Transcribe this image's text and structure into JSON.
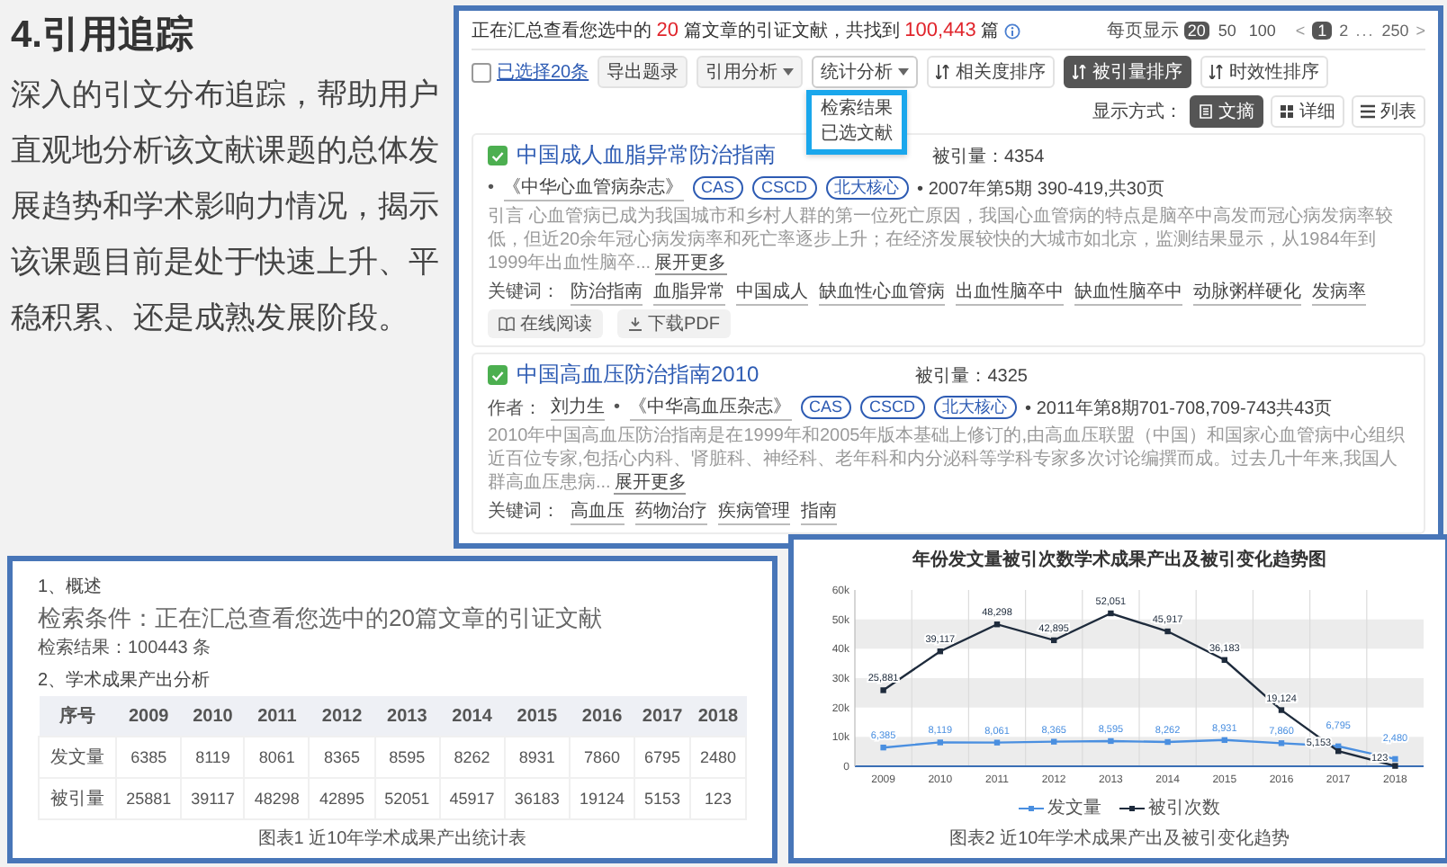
{
  "intro": {
    "heading": "4.引用追踪",
    "body": "深入的引文分布追踪，帮助用户直观地分析该文献课题的总体发展趋势和学术影响力情况，揭示该课题目前是处于快速上升、平稳积累、还是成熟发展阶段。"
  },
  "citation_panel": {
    "summary": [
      {
        "text": "正在汇总查看您选中的 ",
        "emphasis": false
      },
      {
        "text": "20",
        "emphasis": true
      },
      {
        "text": " 篇文章的引证文献，共找到 ",
        "emphasis": false
      },
      {
        "text": "100,443",
        "emphasis": true
      },
      {
        "text": " 篇",
        "emphasis": false
      }
    ],
    "per_page": {
      "label": "每页显示",
      "options": [
        {
          "label": "20",
          "selected": true
        },
        {
          "label": "50",
          "selected": false
        },
        {
          "label": "100",
          "selected": false
        }
      ]
    },
    "pagination": [
      {
        "label": "<",
        "kind": "arrow",
        "selected": false
      },
      {
        "label": "1",
        "kind": "page",
        "selected": true
      },
      {
        "label": "2",
        "kind": "page",
        "selected": false
      },
      {
        "label": "...",
        "kind": "gap",
        "selected": false
      },
      {
        "label": "250",
        "kind": "page",
        "selected": false
      },
      {
        "label": ">",
        "kind": "arrow",
        "selected": false
      }
    ],
    "toolbar": {
      "select_all": {
        "label": "已选择20条",
        "checked": false
      },
      "buttons": [
        {
          "label": "导出题录",
          "kind": "plain",
          "expanded": false
        },
        {
          "label": "引用分析",
          "kind": "dropdown",
          "expanded": false
        },
        {
          "label": "统计分析",
          "kind": "dropdown",
          "expanded": true,
          "menu": [
            "检索结果",
            "已选文献"
          ]
        }
      ],
      "sorts": [
        {
          "label": "相关度排序",
          "selected": false
        },
        {
          "label": "被引量排序",
          "selected": true
        },
        {
          "label": "时效性排序",
          "selected": false
        }
      ],
      "display_label": "显示方式：",
      "display_modes": [
        {
          "label": "文摘",
          "kind": "abstract",
          "selected": true
        },
        {
          "label": "详细",
          "kind": "detail",
          "selected": false
        },
        {
          "label": "列表",
          "kind": "list",
          "selected": false
        }
      ]
    },
    "results": [
      {
        "checked": true,
        "title": "中国成人血脂异常防治指南",
        "cited": "被引量：4354",
        "journal_bullet": "•",
        "journal": "《中华心血管病杂志》",
        "badges": [
          "CAS",
          "CSCD",
          "北大核心"
        ],
        "issue": "• 2007年第5期 390-419,共30页",
        "abstract": "引言 心血管病已成为我国城市和乡村人群的第一位死亡原因，我国心血管病的特点是脑卒中高发而冠心病发病率较低，但近20余年冠心病发病率和死亡率逐步上升；在经济发展较快的大城市如北京，监测结果显示，从1984年到1999年出血性脑卒...",
        "more": "展开更多",
        "keywords_label": "关键词：",
        "keywords": [
          "防治指南",
          "血脂异常",
          "中国成人",
          "缺血性心血管病",
          "出血性脑卒中",
          "缺血性脑卒中",
          "动脉粥样硬化",
          "发病率"
        ],
        "actions": [
          {
            "label": "在线阅读",
            "kind": "read"
          },
          {
            "label": "下载PDF",
            "kind": "download"
          }
        ]
      },
      {
        "checked": true,
        "title": "中国高血压防治指南2010",
        "cited": "被引量：4325",
        "author_label": "作者：",
        "author": "刘力生",
        "journal_bullet": "•",
        "journal": "《中华高血压杂志》",
        "badges": [
          "CAS",
          "CSCD",
          "北大核心"
        ],
        "issue": "• 2011年第8期701-708,709-743共43页",
        "abstract": "2010年中国高血压防治指南是在1999年和2005年版本基础上修订的,由高血压联盟（中国）和国家心血管病中心组织近百位专家,包括心内科、肾脏科、神经科、老年科和内分泌科等学科专家多次讨论编撰而成。过去几十年来,我国人群高血压患病...",
        "more": "展开更多",
        "keywords_label": "关键词：",
        "keywords": [
          "高血压",
          "药物治疗",
          "疾病管理",
          "指南"
        ]
      }
    ]
  },
  "report": {
    "section1": "1、概述",
    "condition": "检索条件：正在汇总查看您选中的20篇文章的引证文献",
    "result": "检索结果：100443 条",
    "section2": "2、学术成果产出分析",
    "table": {
      "columns": [
        "序号",
        "2009",
        "2010",
        "2011",
        "2012",
        "2013",
        "2014",
        "2015",
        "2016",
        "2017",
        "2018"
      ],
      "rows": [
        [
          "发文量",
          "6385",
          "8119",
          "8061",
          "8365",
          "8595",
          "8262",
          "8931",
          "7860",
          "6795",
          "2480"
        ],
        [
          "被引量",
          "25881",
          "39117",
          "48298",
          "42895",
          "52051",
          "45917",
          "36183",
          "19124",
          "5153",
          "123"
        ]
      ]
    },
    "caption": "图表1 近10年学术成果产出统计表"
  },
  "chart_panel": {
    "chart_data": {
      "type": "line",
      "title": "年份发文量被引次数学术成果产出及被引变化趋势图",
      "categories": [
        "2009",
        "2010",
        "2011",
        "2012",
        "2013",
        "2014",
        "2015",
        "2016",
        "2017",
        "2018"
      ],
      "series": [
        {
          "name": "发文量",
          "color": "#4a8fe0",
          "marker": "square",
          "values": [
            6385,
            8119,
            8061,
            8365,
            8595,
            8262,
            8931,
            7860,
            6795,
            2480
          ],
          "value_labels": [
            "6,385",
            "8,119",
            "8,061",
            "8,365",
            "8,595",
            "8,262",
            "8,931",
            "7,860",
            "6,795",
            "2,480"
          ]
        },
        {
          "name": "被引次数",
          "color": "#1e2b3c",
          "marker": "square",
          "values": [
            25881,
            39117,
            48298,
            42895,
            52051,
            45917,
            36183,
            19124,
            5153,
            123
          ],
          "value_labels": [
            "25,881",
            "39,117",
            "48,298",
            "42,895",
            "52,051",
            "45,917",
            "36,183",
            "19,124",
            "5,153",
            "123"
          ]
        }
      ],
      "ylim": [
        0,
        60000
      ],
      "yticks": [
        {
          "value": 0,
          "label": "0"
        },
        {
          "value": 10000,
          "label": "10k"
        },
        {
          "value": 20000,
          "label": "20k"
        },
        {
          "value": 30000,
          "label": "30k"
        },
        {
          "value": 40000,
          "label": "40k"
        },
        {
          "value": 50000,
          "label": "50k"
        },
        {
          "value": 60000,
          "label": "60k"
        }
      ]
    },
    "caption": "图表2 近10年学术成果产出及被引变化趋势"
  }
}
